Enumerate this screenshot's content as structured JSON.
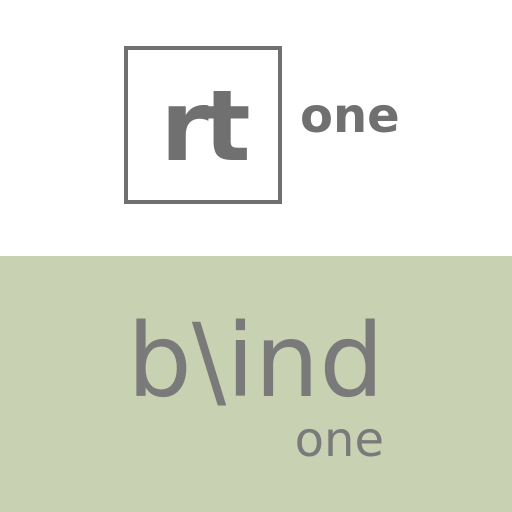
{
  "logo": {
    "letters": "rt",
    "suffix": "one"
  },
  "product": {
    "name": "b\\ind",
    "suffix": "one"
  },
  "colors": {
    "top_background": "#ffffff",
    "bottom_background": "#c8d1b2",
    "logo_gray": "#707070",
    "text_gray": "#7a7a7a"
  }
}
